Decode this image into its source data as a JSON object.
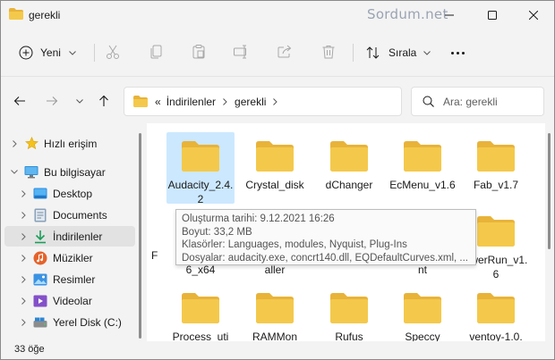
{
  "window": {
    "title": "gerekli",
    "watermark": "Sordum.net"
  },
  "toolbar": {
    "new_label": "Yeni",
    "sort_label": "Sırala",
    "icons": [
      "cut-icon",
      "copy-icon",
      "paste-icon",
      "rename-icon",
      "share-icon",
      "delete-icon"
    ]
  },
  "address": {
    "overflow": "«",
    "crumbs": [
      "İndirilenler",
      "gerekli"
    ],
    "search_placeholder": "Ara: gerekli"
  },
  "sidebar": {
    "items": [
      {
        "label": "Hızlı erişim",
        "icon": "star-icon"
      },
      {
        "label": "Bu bilgisayar",
        "icon": "computer-icon"
      },
      {
        "label": "Desktop",
        "icon": "desktop-icon"
      },
      {
        "label": "Documents",
        "icon": "documents-icon"
      },
      {
        "label": "İndirilenler",
        "icon": "download-icon"
      },
      {
        "label": "Müzikler",
        "icon": "music-icon"
      },
      {
        "label": "Resimler",
        "icon": "pictures-icon"
      },
      {
        "label": "Videolar",
        "icon": "videos-icon"
      },
      {
        "label": "Yerel Disk (C:)",
        "icon": "drive-icon"
      }
    ]
  },
  "files": {
    "row1": [
      "Audacity_2.4.2",
      "Crystal_disk",
      "dChanger",
      "EcMenu_v1.6",
      "Fab_v1.7"
    ],
    "row2": [
      "F",
      "6_x64",
      "aller",
      "nt",
      "owerRun_v1.6"
    ],
    "row3": [
      "Process_uti",
      "RAMMon",
      "Rufus",
      "Speccy",
      "ventoy-1.0."
    ]
  },
  "tooltip": {
    "line1": "Oluşturma tarihi: 9.12.2021 16:26",
    "line2": "Boyut: 33,2 MB",
    "line3": "Klasörler: Languages, modules, Nyquist, Plug-Ins",
    "line4": "Dosyalar: audacity.exe, concrt140.dll, EQDefaultCurves.xml, ..."
  },
  "status": {
    "count": "33 öğe"
  },
  "colors": {
    "folder": "#f4c94b",
    "folder_back": "#e8b339",
    "selection": "#cce8ff",
    "accent": "#0067c0"
  }
}
